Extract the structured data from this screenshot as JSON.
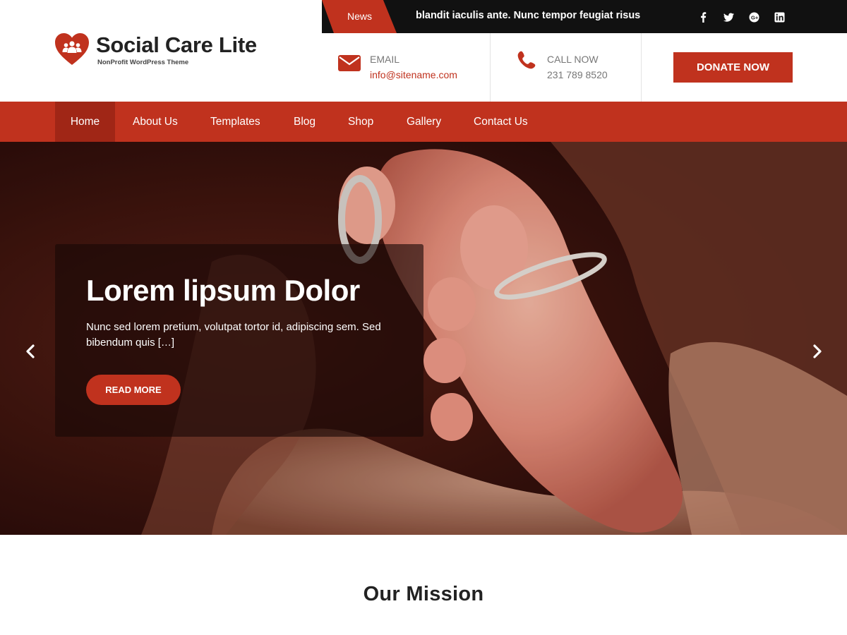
{
  "topbar": {
    "news_label": "News",
    "ticker_text": "blandit iaculis ante. Nunc tempor feugiat risus",
    "social": [
      {
        "icon": "facebook-icon"
      },
      {
        "icon": "twitter-icon"
      },
      {
        "icon": "google-plus-icon"
      },
      {
        "icon": "linkedin-icon"
      }
    ]
  },
  "logo": {
    "title": "Social Care Lite",
    "tagline": "NonProfit WordPress Theme",
    "icon": "heart-people-icon"
  },
  "contact": {
    "email_label": "EMAIL",
    "email_value": "info@sitename.com",
    "call_label": "CALL NOW",
    "call_value": "231 789 8520"
  },
  "donate_label": "DONATE NOW",
  "nav": {
    "items": [
      {
        "label": "Home",
        "active": true
      },
      {
        "label": "About Us"
      },
      {
        "label": "Templates"
      },
      {
        "label": "Blog"
      },
      {
        "label": "Shop"
      },
      {
        "label": "Gallery"
      },
      {
        "label": "Contact Us"
      }
    ]
  },
  "hero": {
    "title": "Lorem lipsum Dolor",
    "text": "Nunc sed lorem pretium, volutpat tortor id, adipiscing sem. Sed bibendum quis […]",
    "button_label": "READ MORE"
  },
  "mission": {
    "title": "Our Mission"
  },
  "colors": {
    "accent": "#c0321e",
    "nav_active": "#a02616",
    "topbar": "#111111"
  }
}
